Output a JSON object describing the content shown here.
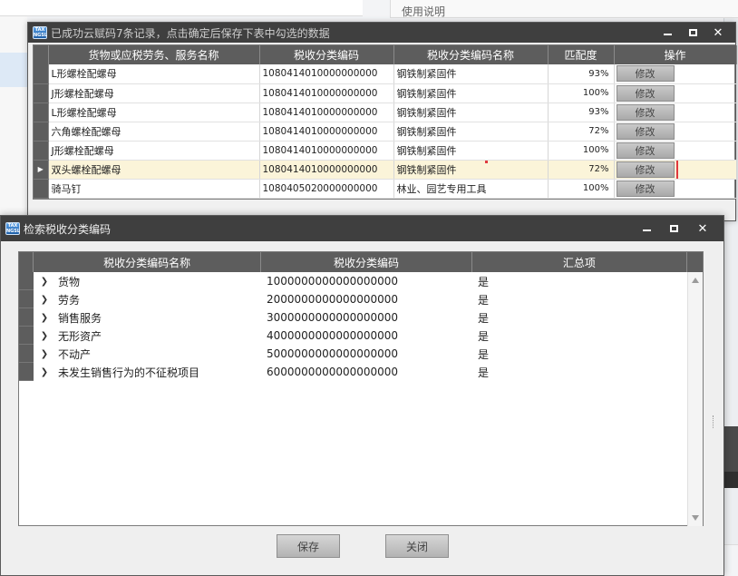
{
  "background": {
    "right_card_title": "使用说明"
  },
  "match_window": {
    "title": "已成功云赋码7条记录，点击确定后保存下表中勾选的数据",
    "columns": [
      "货物或应税劳务、服务名称",
      "税收分类编码",
      "税收分类编码名称",
      "匹配度",
      "操作"
    ],
    "rows": [
      {
        "name": "L形螺栓配螺母",
        "code": "1080414010000000000",
        "code_name": "钢铁制紧固件",
        "match": "93%",
        "action": "修改",
        "selected": false
      },
      {
        "name": "J形螺栓配螺母",
        "code": "1080414010000000000",
        "code_name": "钢铁制紧固件",
        "match": "100%",
        "action": "修改",
        "selected": false
      },
      {
        "name": "L形螺栓配螺母",
        "code": "1080414010000000000",
        "code_name": "钢铁制紧固件",
        "match": "93%",
        "action": "修改",
        "selected": false
      },
      {
        "name": "六角螺栓配螺母",
        "code": "1080414010000000000",
        "code_name": "钢铁制紧固件",
        "match": "72%",
        "action": "修改",
        "selected": false
      },
      {
        "name": "J形螺栓配螺母",
        "code": "1080414010000000000",
        "code_name": "钢铁制紧固件",
        "match": "100%",
        "action": "修改",
        "selected": false
      },
      {
        "name": "双头螺栓配螺母",
        "code": "1080414010000000000",
        "code_name": "钢铁制紧固件",
        "match": "72%",
        "action": "修改",
        "selected": true
      },
      {
        "name": "骑马钉",
        "code": "1080405020000000000",
        "code_name": "林业、园艺专用工具",
        "match": "100%",
        "action": "修改",
        "selected": false
      }
    ],
    "highlight_color": "#e0393e"
  },
  "search_window": {
    "title": "检索税收分类编码",
    "columns": [
      "税收分类编码名称",
      "税收分类编码",
      "汇总项"
    ],
    "rows": [
      {
        "name": "货物",
        "code": "1000000000000000000",
        "summary": "是"
      },
      {
        "name": "劳务",
        "code": "2000000000000000000",
        "summary": "是"
      },
      {
        "name": "销售服务",
        "code": "3000000000000000000",
        "summary": "是"
      },
      {
        "name": "无形资产",
        "code": "4000000000000000000",
        "summary": "是"
      },
      {
        "name": "不动产",
        "code": "5000000000000000000",
        "summary": "是"
      },
      {
        "name": "未发生销售行为的不征税项目",
        "code": "6000000000000000000",
        "summary": "是"
      }
    ],
    "save_label": "保存",
    "close_label": "关闭"
  },
  "icons": {
    "app": "tax-app-icon",
    "minimize": "minimize-icon",
    "maximize": "maximize-icon",
    "close": "close-icon",
    "expand": "chevron-right-icon"
  }
}
